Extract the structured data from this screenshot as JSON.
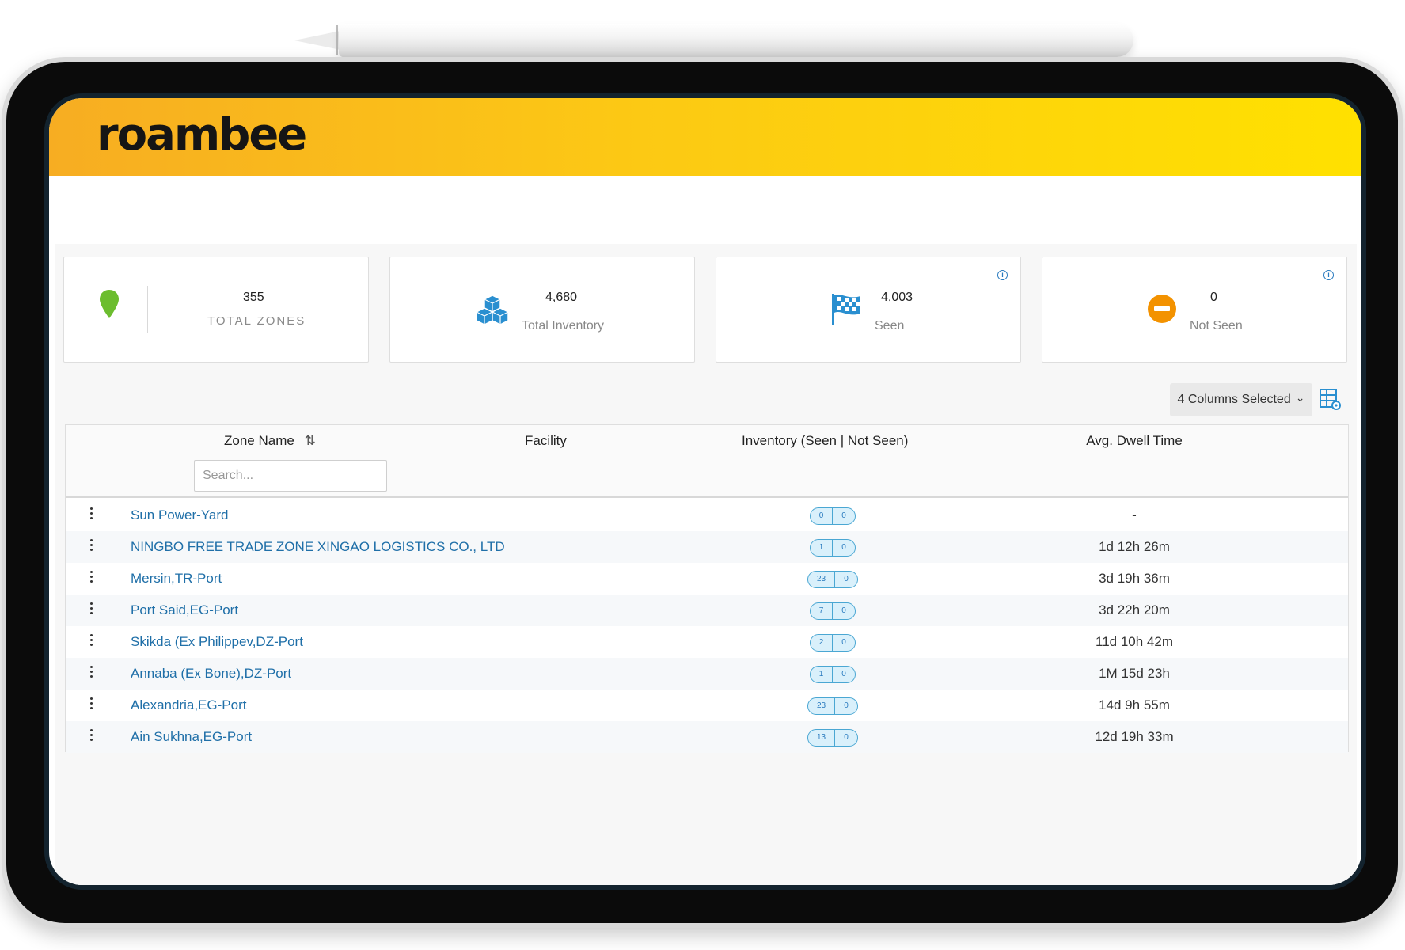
{
  "brand": {
    "logo_text": "roambee",
    "accent": "#fcc914"
  },
  "stats": {
    "total_zones": {
      "value": "355",
      "label": "TOTAL ZONES",
      "icon": "map-pin-icon",
      "color": "#6cbd2f"
    },
    "total_inventory": {
      "value": "4,680",
      "label": "Total Inventory",
      "icon": "boxes-icon",
      "color": "#2a8fd0"
    },
    "seen": {
      "value": "4,003",
      "label": "Seen",
      "icon": "checkered-flag-icon",
      "color": "#2a8fd0"
    },
    "not_seen": {
      "value": "0",
      "label": "Not Seen",
      "icon": "minus-circle-icon",
      "color": "#f39200"
    },
    "info_glyph": "i"
  },
  "toolbar": {
    "columns_selected_label": "4 Columns Selected",
    "chevron": "⌄"
  },
  "table": {
    "headers": {
      "zone_name": "Zone Name",
      "sort_glyph": "⇅",
      "facility": "Facility",
      "inventory": "Inventory (Seen | Not Seen)",
      "avg_dwell": "Avg. Dwell Time"
    },
    "search_placeholder": "Search...",
    "rows": [
      {
        "zone": "Sun Power-Yard",
        "seen": "0",
        "not_seen": "0",
        "dwell": "-"
      },
      {
        "zone": "NINGBO FREE TRADE ZONE XINGAO LOGISTICS CO., LTD",
        "seen": "1",
        "not_seen": "0",
        "dwell": "1d 12h 26m"
      },
      {
        "zone": "Mersin,TR-Port",
        "seen": "23",
        "not_seen": "0",
        "dwell": "3d 19h 36m"
      },
      {
        "zone": "Port Said,EG-Port",
        "seen": "7",
        "not_seen": "0",
        "dwell": "3d 22h 20m"
      },
      {
        "zone": "Skikda (Ex Philippev,DZ-Port",
        "seen": "2",
        "not_seen": "0",
        "dwell": "11d 10h 42m"
      },
      {
        "zone": "Annaba (Ex Bone),DZ-Port",
        "seen": "1",
        "not_seen": "0",
        "dwell": "1M 15d 23h"
      },
      {
        "zone": "Alexandria,EG-Port",
        "seen": "23",
        "not_seen": "0",
        "dwell": "14d 9h 55m"
      },
      {
        "zone": "Ain Sukhna,EG-Port",
        "seen": "13",
        "not_seen": "0",
        "dwell": "12d 19h 33m"
      }
    ]
  }
}
